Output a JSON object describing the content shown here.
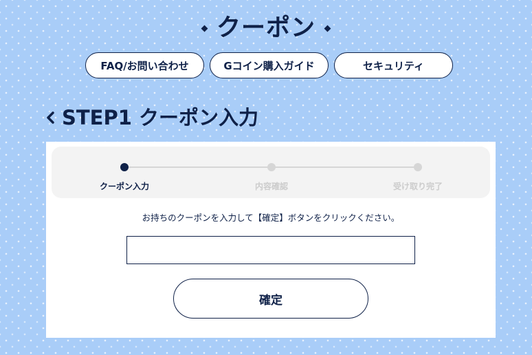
{
  "header": {
    "title": "クーポン"
  },
  "top_links": [
    {
      "label": "FAQ/お問い合わせ"
    },
    {
      "label": "Gコイン購入ガイド"
    },
    {
      "label": "セキュリティ"
    }
  ],
  "step_heading": {
    "label": "STEP1 クーポン入力"
  },
  "progress": {
    "steps": [
      {
        "label": "クーポン入力",
        "active": true
      },
      {
        "label": "内容確認",
        "active": false
      },
      {
        "label": "受け取り完了",
        "active": false
      }
    ]
  },
  "form": {
    "instruction": "お持ちのクーポンを入力して【確定】ボタンをクリックください。",
    "coupon_value": "",
    "confirm_label": "確定"
  },
  "colors": {
    "background": "#a9cdf8",
    "accent": "#0f2148",
    "inactive": "#d6d6d6"
  }
}
